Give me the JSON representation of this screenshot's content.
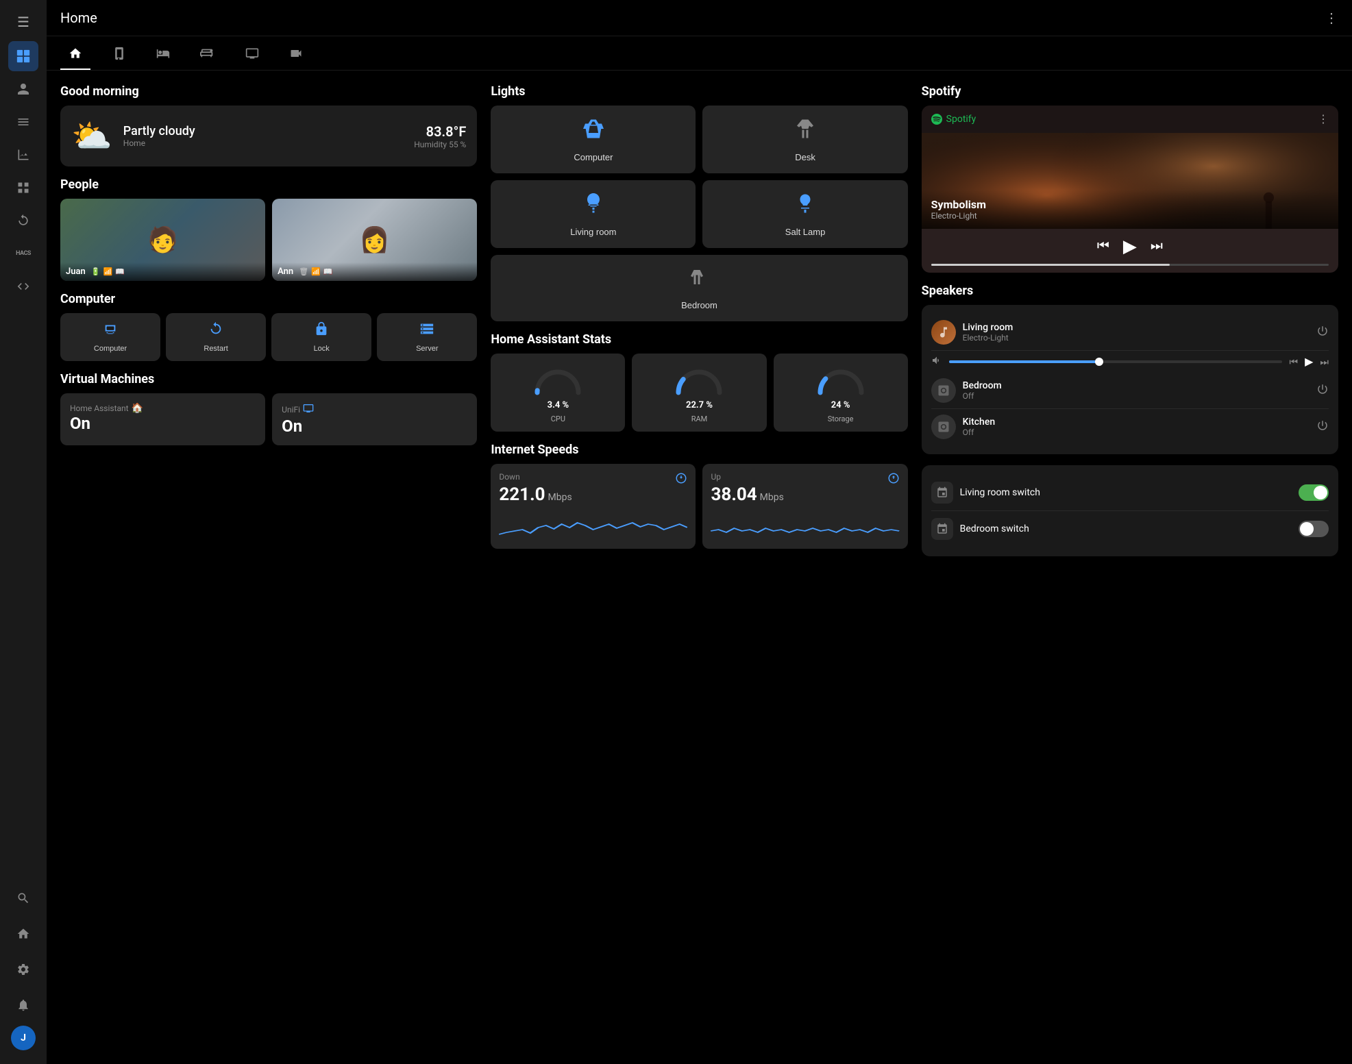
{
  "header": {
    "title": "Home",
    "more_icon": "⋮"
  },
  "sidebar": {
    "menu_icon": "☰",
    "items": [
      {
        "id": "dashboard",
        "icon": "⊞",
        "active": true
      },
      {
        "id": "person",
        "icon": "👤"
      },
      {
        "id": "list",
        "icon": "≡"
      },
      {
        "id": "chart",
        "icon": "📊"
      },
      {
        "id": "grid",
        "icon": "▦"
      },
      {
        "id": "reload",
        "icon": "↻"
      },
      {
        "id": "hacs",
        "icon": "HACS"
      },
      {
        "id": "code",
        "icon": "</>"
      },
      {
        "id": "tools",
        "icon": "🔧"
      },
      {
        "id": "home2",
        "icon": "⌂"
      },
      {
        "id": "settings",
        "icon": "⚙"
      }
    ],
    "bottom": {
      "bell_icon": "🔔",
      "avatar_label": "J"
    }
  },
  "tabs": [
    {
      "id": "home",
      "icon": "⌂",
      "active": true
    },
    {
      "id": "mobile",
      "icon": "📱"
    },
    {
      "id": "bed1",
      "icon": "🛏"
    },
    {
      "id": "bed2",
      "icon": "🛌"
    },
    {
      "id": "tv",
      "icon": "📺"
    },
    {
      "id": "camera",
      "icon": "📹"
    }
  ],
  "greeting": {
    "section_label": "Good morning"
  },
  "weather": {
    "description": "Partly cloudy",
    "location": "Home",
    "temperature": "83.8°F",
    "humidity_label": "Humidity 55 %",
    "icon": "⛅"
  },
  "people": {
    "section_label": "People",
    "persons": [
      {
        "name": "Juan",
        "icons": [
          "🔋",
          "📶",
          "📖"
        ]
      },
      {
        "name": "Ann",
        "icons": [
          "🗑",
          "📶",
          "📖"
        ]
      }
    ]
  },
  "computer": {
    "section_label": "Computer",
    "buttons": [
      {
        "id": "computer",
        "label": "Computer",
        "icon": "💻"
      },
      {
        "id": "restart",
        "label": "Restart",
        "icon": "↺"
      },
      {
        "id": "lock",
        "label": "Lock",
        "icon": "🔒"
      },
      {
        "id": "server",
        "label": "Server",
        "icon": "🗄"
      }
    ]
  },
  "vms": {
    "section_label": "Virtual Machines",
    "items": [
      {
        "id": "homeassistant",
        "label": "Home Assistant",
        "status": "On",
        "icon": "🏠"
      },
      {
        "id": "unifi",
        "label": "UniFi",
        "status": "On",
        "icon": "🖥"
      }
    ]
  },
  "lights": {
    "section_label": "Lights",
    "items": [
      {
        "id": "computer",
        "label": "Computer",
        "active": true
      },
      {
        "id": "desk",
        "label": "Desk",
        "active": false
      },
      {
        "id": "living_room",
        "label": "Living room",
        "active": true
      },
      {
        "id": "salt_lamp",
        "label": "Salt Lamp",
        "active": true
      },
      {
        "id": "bedroom",
        "label": "Bedroom",
        "active": false
      }
    ]
  },
  "ha_stats": {
    "section_label": "Home Assistant Stats",
    "items": [
      {
        "id": "cpu",
        "label": "CPU",
        "value": "3.4 %",
        "percent": 3.4,
        "color": "#4a9eff"
      },
      {
        "id": "ram",
        "label": "RAM",
        "value": "22.7 %",
        "percent": 22.7,
        "color": "#4a9eff"
      },
      {
        "id": "storage",
        "label": "Storage",
        "value": "24 %",
        "percent": 24,
        "color": "#4a9eff"
      }
    ]
  },
  "internet": {
    "section_label": "Internet Speeds",
    "down": {
      "label": "Down",
      "value": "221.0",
      "unit": "Mbps"
    },
    "up": {
      "label": "Up",
      "value": "38.04",
      "unit": "Mbps"
    }
  },
  "spotify": {
    "section_label": "Spotify",
    "brand": "Spotify",
    "track": "Symbolism",
    "artist": "Electro-Light",
    "progress": 60
  },
  "speakers": {
    "section_label": "Speakers",
    "items": [
      {
        "id": "living_room",
        "name": "Living room",
        "sub": "Electro-Light",
        "active": true
      },
      {
        "id": "bedroom",
        "name": "Bedroom",
        "sub": "Off",
        "active": false
      },
      {
        "id": "kitchen",
        "name": "Kitchen",
        "sub": "Off",
        "active": false
      }
    ]
  },
  "switches": {
    "items": [
      {
        "id": "living_room_switch",
        "name": "Living room switch",
        "on": true
      },
      {
        "id": "bedroom_switch",
        "name": "Bedroom switch",
        "on": false
      }
    ]
  }
}
